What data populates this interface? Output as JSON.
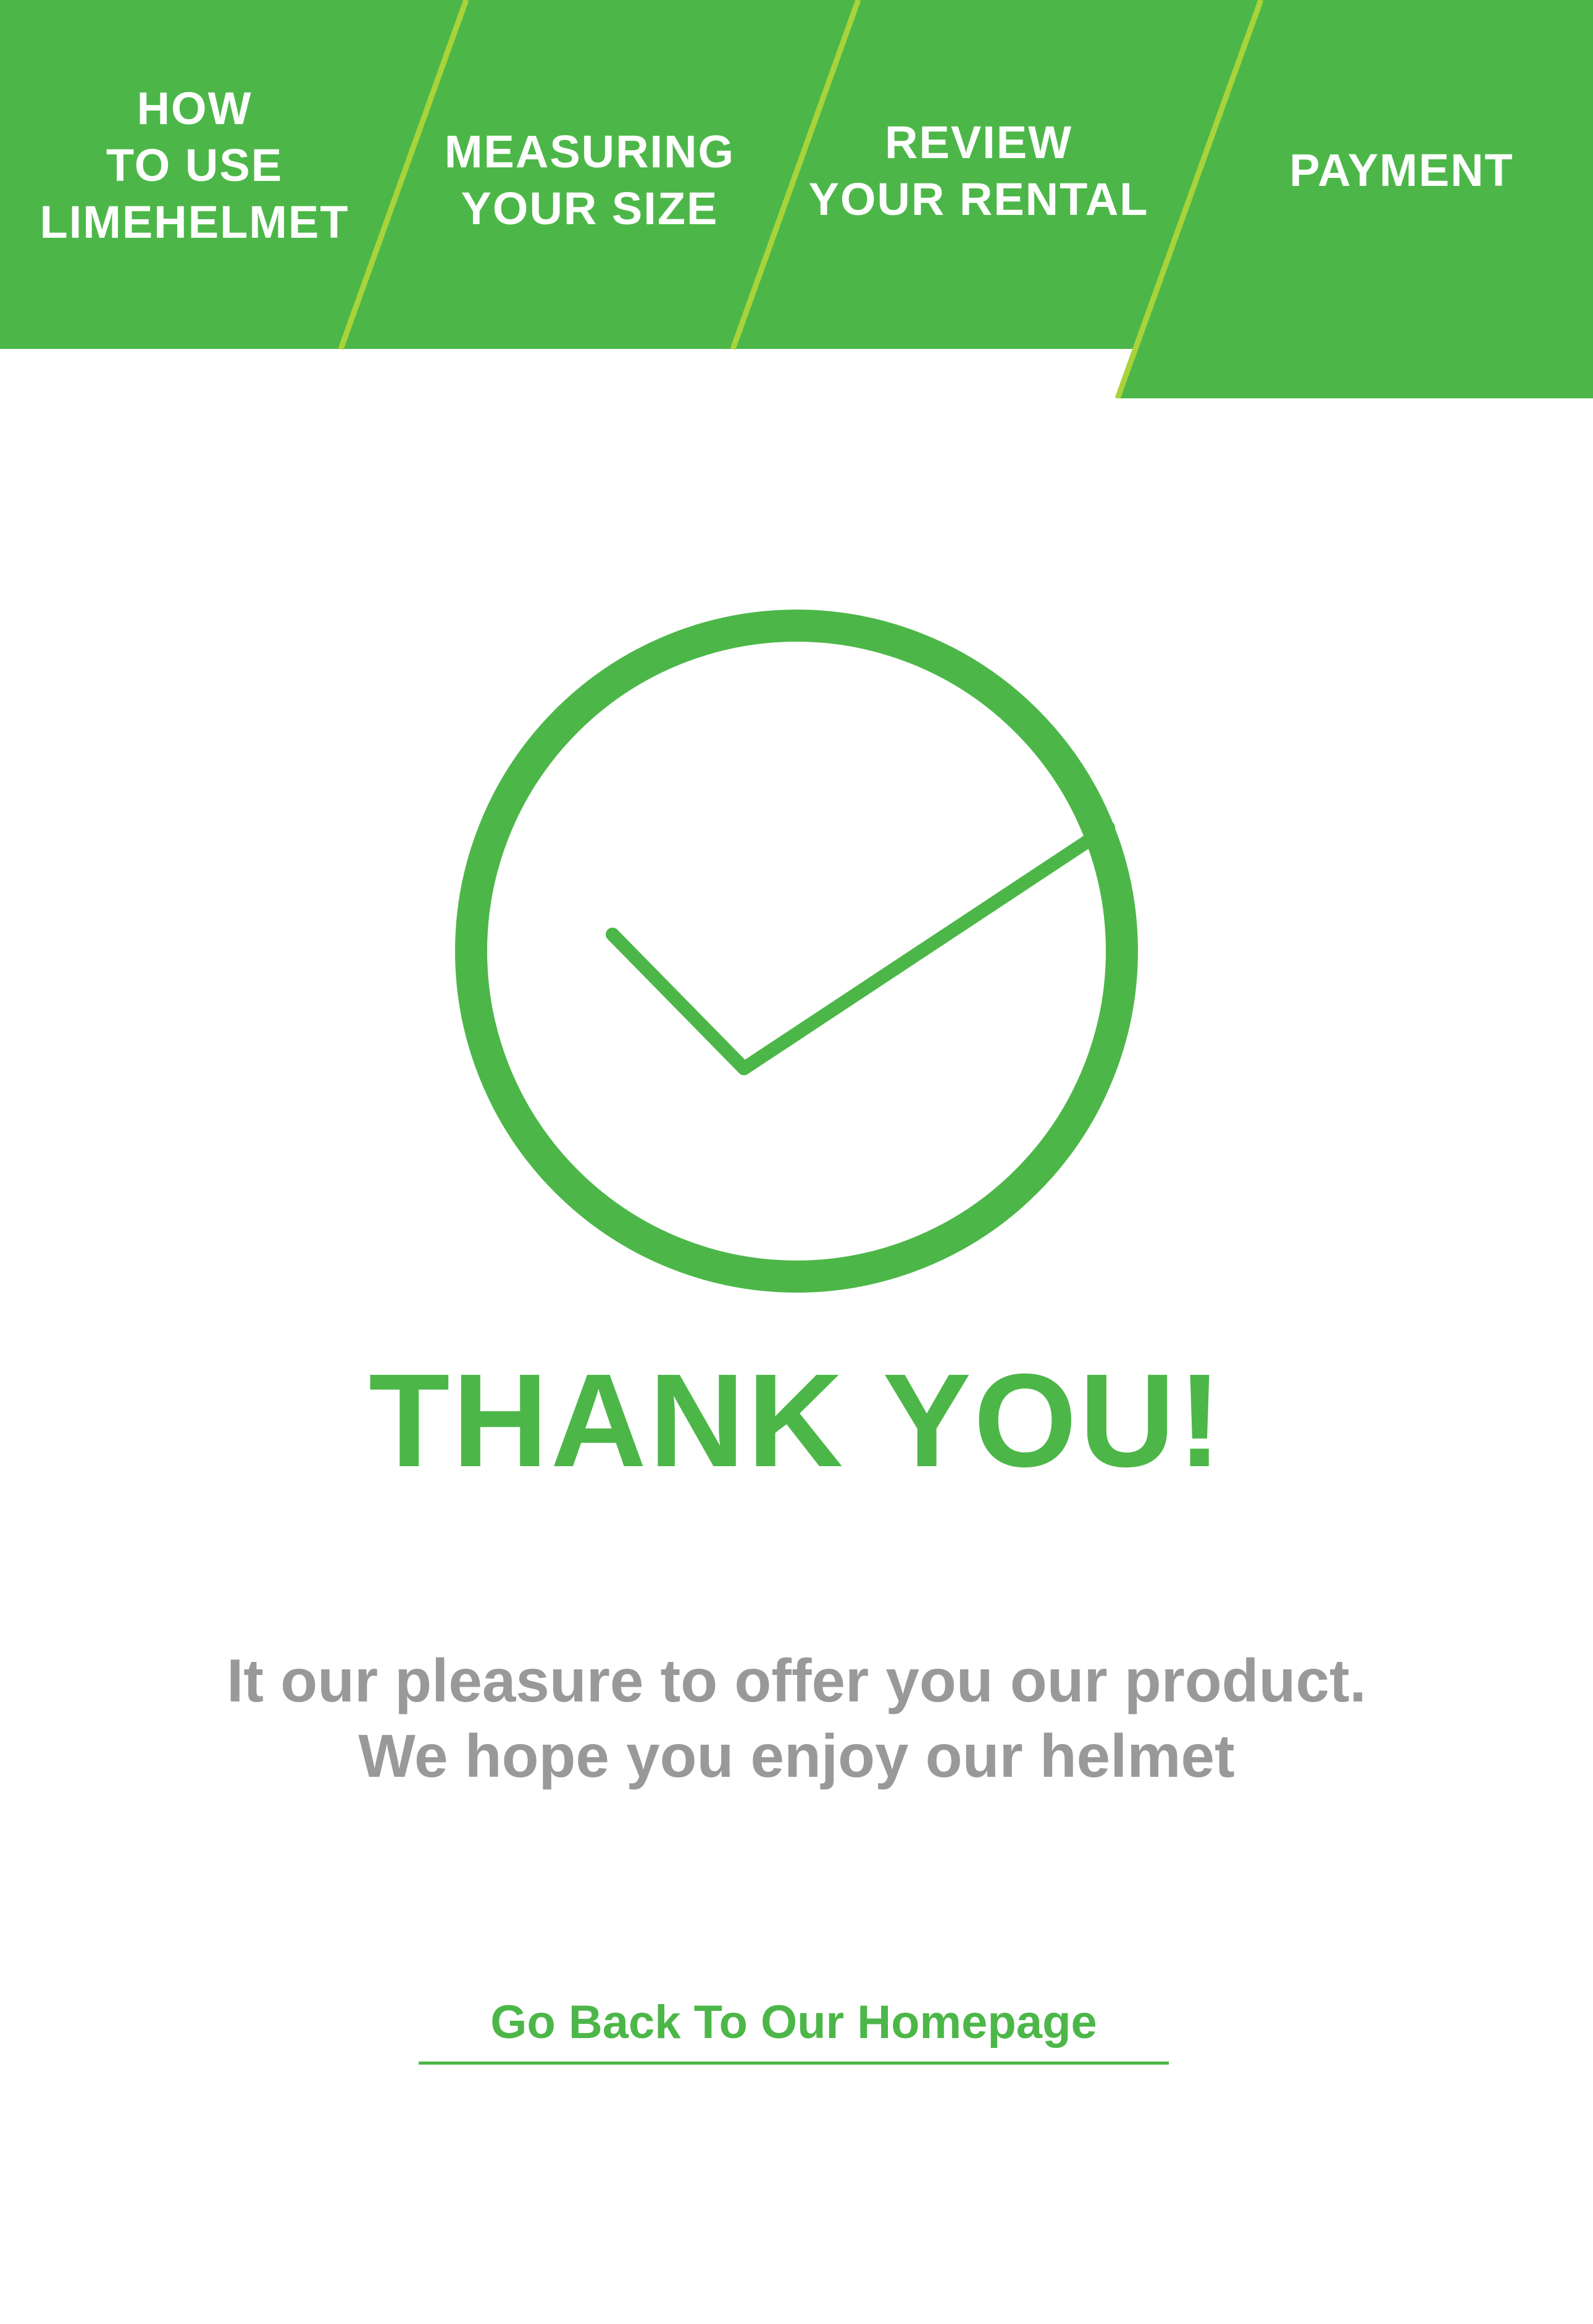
{
  "stepper": {
    "steps": [
      {
        "label": "HOW\nTO USE\nLIMEHELMET"
      },
      {
        "label": "MEASURING\nYOUR SIZE"
      },
      {
        "label": "REVIEW\nYOUR RENTAL"
      },
      {
        "label": "PAYMENT"
      }
    ],
    "active_index": 3
  },
  "icon": "check-circle-icon",
  "title": "THANK YOU!",
  "message": {
    "line1": "It our pleasure to offer you our product.",
    "line2": "We hope you enjoy our helmet"
  },
  "home_link": "Go Back To Our Homepage",
  "colors": {
    "brand_green": "#4cb748",
    "divider_lime": "#a8d33a",
    "text_gray": "#999999",
    "background": "#ffffff"
  }
}
